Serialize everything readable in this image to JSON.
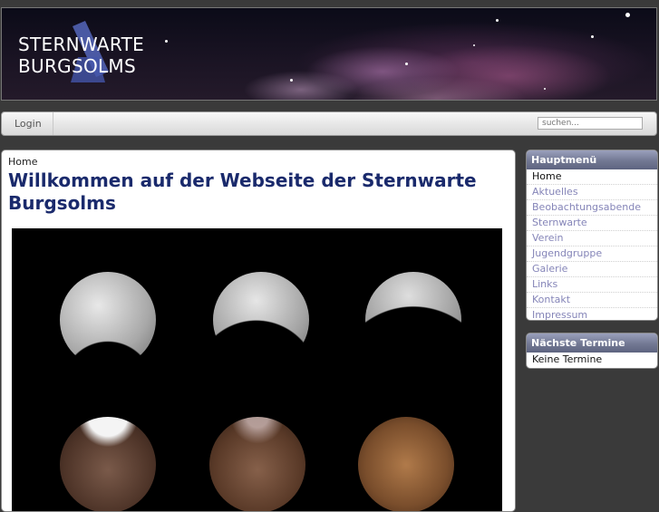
{
  "header": {
    "logo_line1": "STERNWARTE",
    "logo_line2": "BURGSOLMS"
  },
  "nav": {
    "login_label": "Login",
    "search_placeholder": "suchen..."
  },
  "content": {
    "breadcrumb": "Home",
    "title": "Willkommen auf der Webseite der Sternwarte Burgsolms"
  },
  "sidebar": {
    "main_menu": {
      "heading": "Hauptmenü",
      "items": [
        {
          "label": "Home"
        },
        {
          "label": "Aktuelles"
        },
        {
          "label": "Beobachtungsabende"
        },
        {
          "label": "Sternwarte"
        },
        {
          "label": "Verein"
        },
        {
          "label": "Jugendgruppe"
        },
        {
          "label": "Galerie"
        },
        {
          "label": "Links"
        },
        {
          "label": "Kontakt"
        },
        {
          "label": "Impressum"
        }
      ]
    },
    "events": {
      "heading": "Nächste Termine",
      "text": "Keine Termine"
    }
  },
  "colors": {
    "title": "#1a2a6c",
    "menu_link": "#8585b8",
    "module_header": "#727893"
  }
}
